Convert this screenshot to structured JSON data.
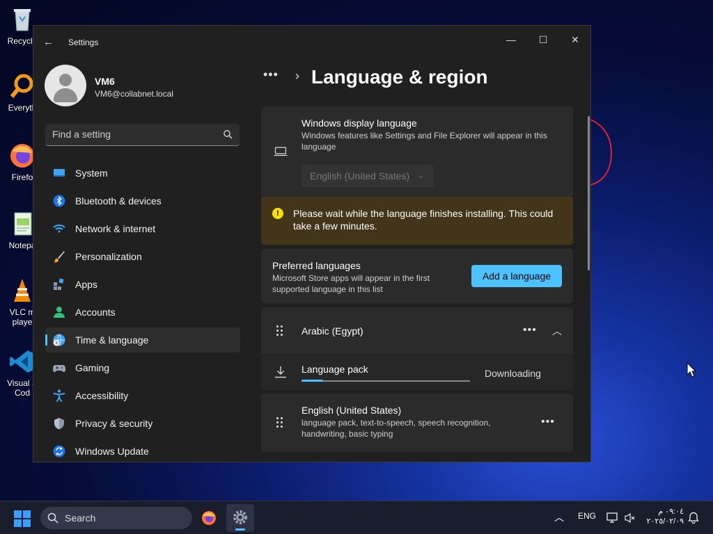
{
  "desktop": {
    "icons": [
      {
        "label": "Recycle",
        "icon": "recycle-bin-icon"
      },
      {
        "label": "Everyth",
        "icon": "everything-app-icon"
      },
      {
        "label": "Firefo",
        "icon": "firefox-icon"
      },
      {
        "label": "Notepa",
        "icon": "notepad-icon"
      },
      {
        "label": "VLC m\nplaye",
        "icon": "vlc-icon"
      },
      {
        "label": "Visual S\nCod",
        "icon": "vscode-icon"
      }
    ]
  },
  "window": {
    "title": "Settings",
    "back_glyph": "←",
    "minimize_glyph": "—",
    "maximize_glyph": "☐",
    "close_glyph": "✕"
  },
  "user": {
    "name": "VM6",
    "email": "VM6@collabnet.local"
  },
  "search": {
    "placeholder": "Find a setting"
  },
  "nav": {
    "items": [
      {
        "label": "System",
        "icon": "system-icon",
        "active": false
      },
      {
        "label": "Bluetooth & devices",
        "icon": "bluetooth-icon",
        "active": false
      },
      {
        "label": "Network & internet",
        "icon": "wifi-icon",
        "active": false
      },
      {
        "label": "Personalization",
        "icon": "brush-icon",
        "active": false
      },
      {
        "label": "Apps",
        "icon": "apps-icon",
        "active": false
      },
      {
        "label": "Accounts",
        "icon": "accounts-icon",
        "active": false
      },
      {
        "label": "Time & language",
        "icon": "time-language-icon",
        "active": true
      },
      {
        "label": "Gaming",
        "icon": "gamepad-icon",
        "active": false
      },
      {
        "label": "Accessibility",
        "icon": "accessibility-icon",
        "active": false
      },
      {
        "label": "Privacy & security",
        "icon": "shield-icon",
        "active": false
      },
      {
        "label": "Windows Update",
        "icon": "update-icon",
        "active": false
      }
    ]
  },
  "breadcrumb": {
    "dots": "•••",
    "separator": "›",
    "title": "Language & region"
  },
  "display_language": {
    "title": "Windows display language",
    "description": "Windows features like Settings and File Explorer will appear in this language",
    "selected": "English (United States)"
  },
  "warning": {
    "glyph": "!",
    "text": "Please wait while the language finishes installing. This could take a few minutes."
  },
  "preferred": {
    "title": "Preferred languages",
    "description": "Microsoft Store apps will appear in the first supported language in this list",
    "add_button": "Add a language"
  },
  "languages": [
    {
      "name": "Arabic (Egypt)",
      "more_glyph": "•••",
      "collapse_glyph": "︿",
      "pack": {
        "label": "Language pack",
        "status": "Downloading",
        "progress": 0.13
      }
    },
    {
      "name": "English (United States)",
      "more_glyph": "•••",
      "features": "language pack, text-to-speech, speech recognition, handwriting, basic typing"
    }
  ],
  "taskbar": {
    "search_label": "Search",
    "input_lang": "ENG",
    "clock_time": "٠٩:٠٤ م",
    "clock_date": "٢٠٢٥/٠٢/٠٩",
    "chevron_glyph": "︿"
  },
  "colors": {
    "accent": "#4cc2ff",
    "warning_bg": "#433519",
    "window_bg": "#202020",
    "card_bg": "#2b2b2b"
  }
}
